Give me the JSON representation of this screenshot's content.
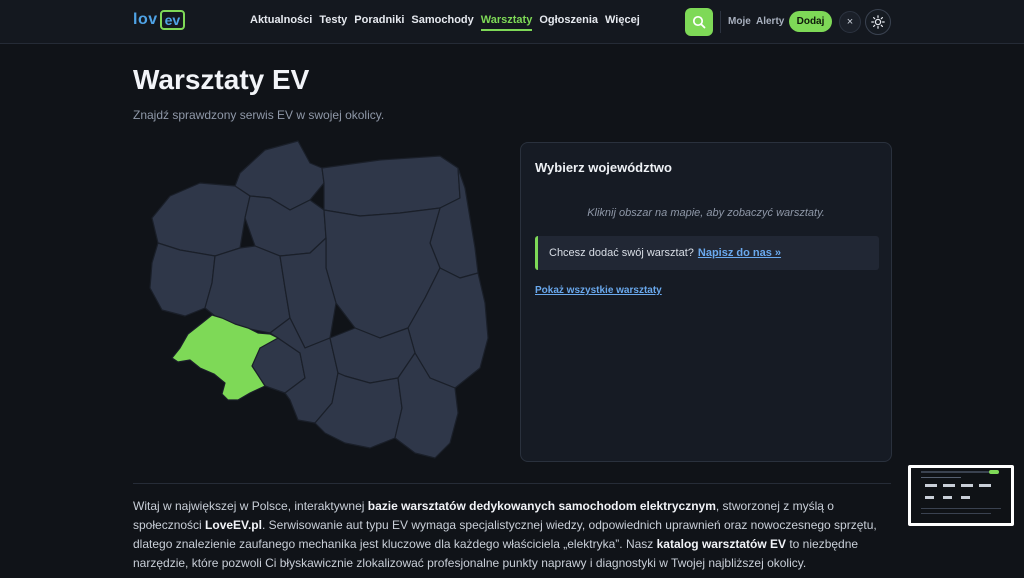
{
  "brand": {
    "logo_text": "lov",
    "logo_box": "ev"
  },
  "nav": [
    {
      "label": "Aktualności",
      "active": false
    },
    {
      "label": "Testy",
      "active": false
    },
    {
      "label": "Poradniki",
      "active": false
    },
    {
      "label": "Samochody",
      "active": false
    },
    {
      "label": "Warsztaty",
      "active": true
    },
    {
      "label": "Ogłoszenia",
      "active": false
    },
    {
      "label": "Więcej",
      "active": false
    }
  ],
  "header": {
    "moje": "Moje",
    "alerty": "Alerty",
    "add_label": "Dodaj",
    "close_glyph": "×"
  },
  "page": {
    "title": "Warsztaty EV",
    "subtitle": "Znajdź sprawdzony serwis EV w swojej okolicy."
  },
  "panel": {
    "title": "Wybierz województwo",
    "hint": "Kliknij obszar na mapie, aby zobaczyć warsztaty.",
    "cta_text": "Chcesz dodać swój warsztat?",
    "cta_link": "Napisz do nas »",
    "show_all": "Pokaż wszystkie warsztaty"
  },
  "intro": {
    "p1": "Witaj w największej w Polsce, interaktywnej ",
    "b1": "bazie warsztatów dedykowanych samochodom elektrycznym",
    "p2": ", stworzonej z myślą o społeczności ",
    "b2": "LoveEV.pl",
    "p3": ". Serwisowanie aut typu EV wymaga specjalistycznej wiedzy, odpowiednich uprawnień oraz nowoczesnego sprzętu, dlatego znalezienie zaufanego mechanika jest kluczowe dla każdego właściciela „elektryka”. Nasz ",
    "b3": "katalog warsztatów EV",
    "p4": " to niezbędne narzędzie, które pozwoli Ci błyskawicznie zlokalizować profesjonalne punkty naprawy i diagnostyki w Twojej najbliższej okolicy."
  },
  "colors": {
    "accent": "#7ed957",
    "link": "#6aa9ee",
    "map_region": "#2f3749",
    "map_border": "#1a1f29",
    "map_highlight": "#7ed957"
  },
  "icons": {
    "search": "search-icon",
    "theme": "sun-icon",
    "close": "close-icon"
  }
}
